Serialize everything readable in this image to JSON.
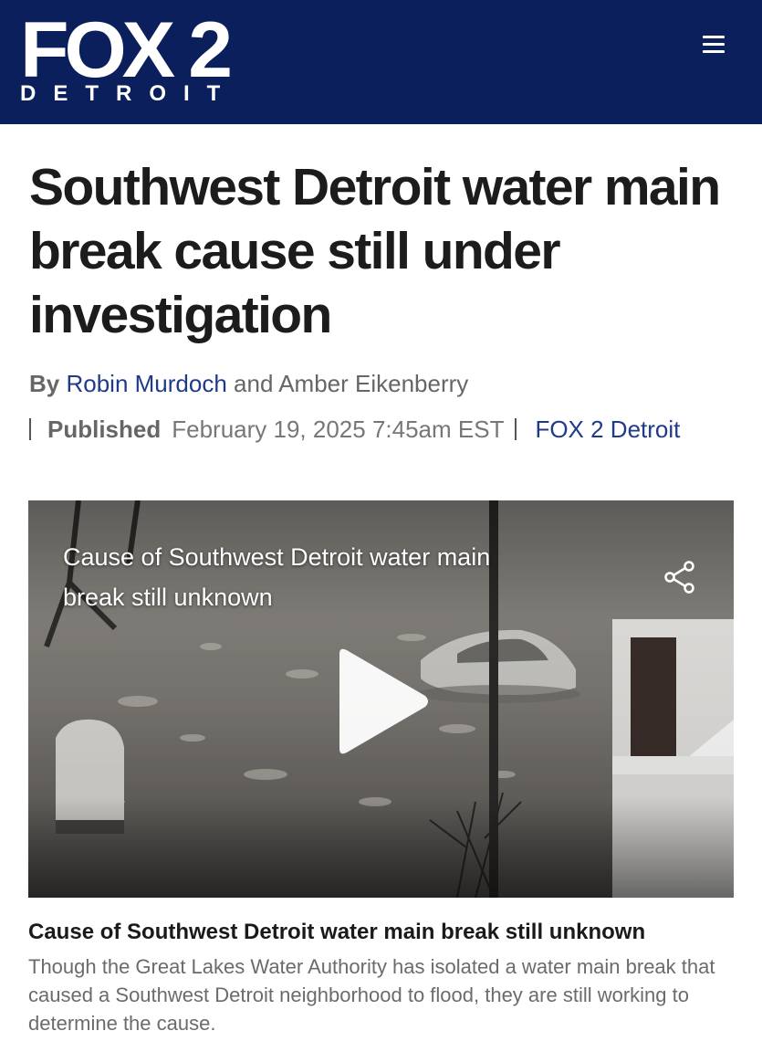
{
  "header": {
    "logo_main": "FOX 2",
    "logo_sub": "DETROIT",
    "menu_icon": "hamburger-menu-icon",
    "background_color": "#0b1f5c"
  },
  "article": {
    "headline": "Southwest Detroit water main break cause still under investigation",
    "byline": {
      "prefix": "By",
      "author_1": "Robin Murdoch",
      "conjunction": "and",
      "author_2": "Amber Eikenberry"
    },
    "meta": {
      "published_label": "Published",
      "date": "February 19, 2025 7:45am EST",
      "source": "FOX 2 Detroit"
    }
  },
  "video": {
    "overlay_title": "Cause of Southwest Detroit water main break still unknown",
    "share_icon": "share-icon",
    "play_icon": "play-icon"
  },
  "caption": {
    "title": "Cause of Southwest Detroit water main break still unknown",
    "body": "Though the Great Lakes Water Authority has isolated a water main break that caused a Southwest Detroit neighborhood to flood, they are still working to determine the cause."
  },
  "colors": {
    "accent_link": "#1f3a8a",
    "headline_text": "#1c1c1c",
    "muted_text": "#6b6b6b"
  }
}
